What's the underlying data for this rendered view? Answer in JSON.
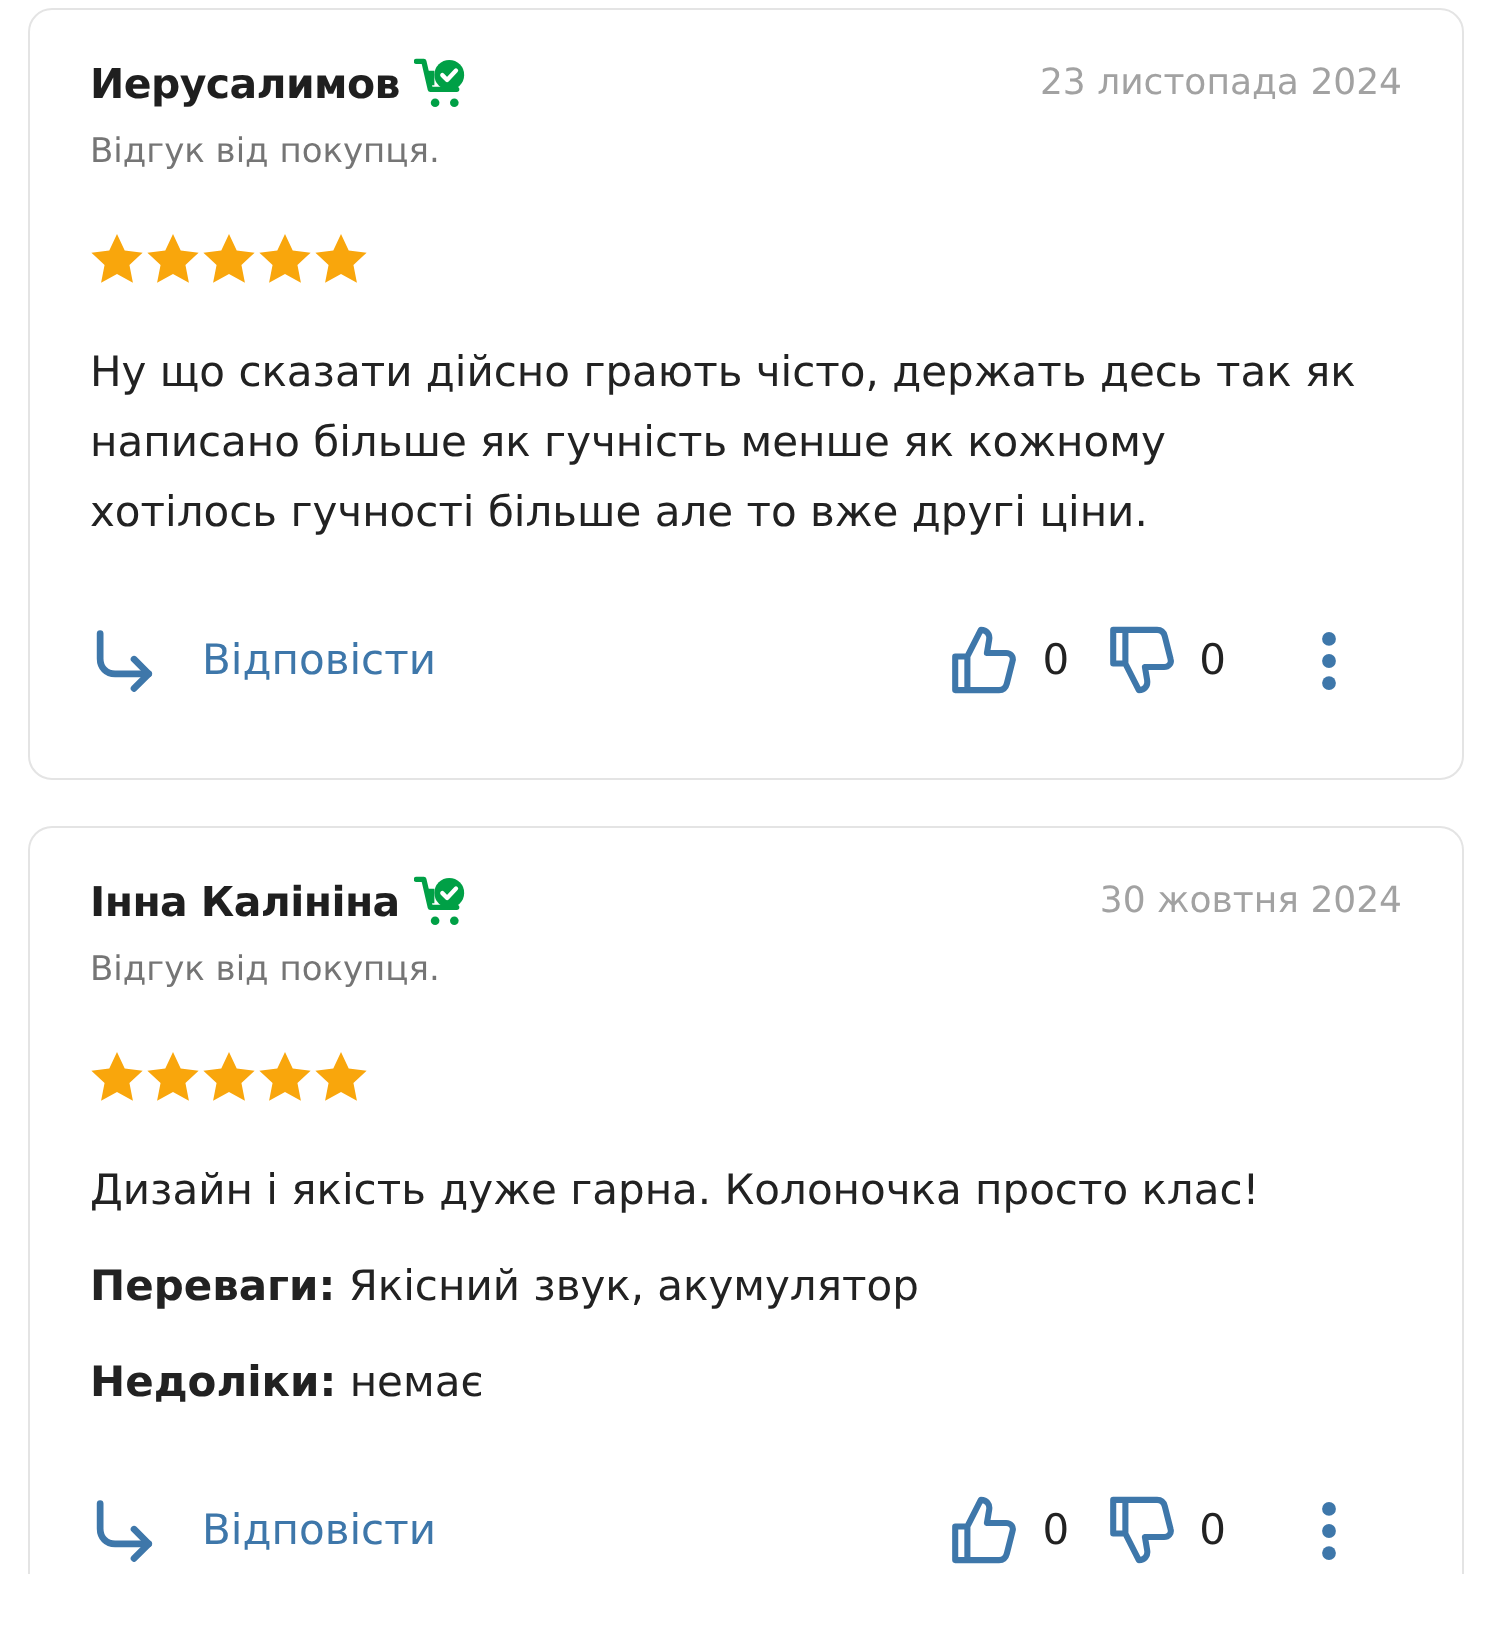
{
  "reviews": [
    {
      "author": "Иерусалимов",
      "verified_buyer": true,
      "date": "23 листопада 2024",
      "subtitle": "Відгук від покупця.",
      "stars": 5,
      "text": "Ну що сказати дійсно грають чісто, держать десь так як написано більше як гучність менше як кожному хотілось гучності більше але то вже другі ціни.",
      "reply_label": "Відповісти",
      "likes": "0",
      "dislikes": "0"
    },
    {
      "author": "Інна Калініна",
      "verified_buyer": true,
      "date": "30 жовтня 2024",
      "subtitle": "Відгук від покупця.",
      "stars": 5,
      "text": "Дизайн і якість дуже гарна. Колоночка просто клас!",
      "details": [
        "**Переваги:** Якісний звук, акумулятор",
        "**Недоліки:** немає"
      ],
      "reply_label": "Відповісти",
      "likes": "0",
      "dislikes": "0"
    }
  ]
}
